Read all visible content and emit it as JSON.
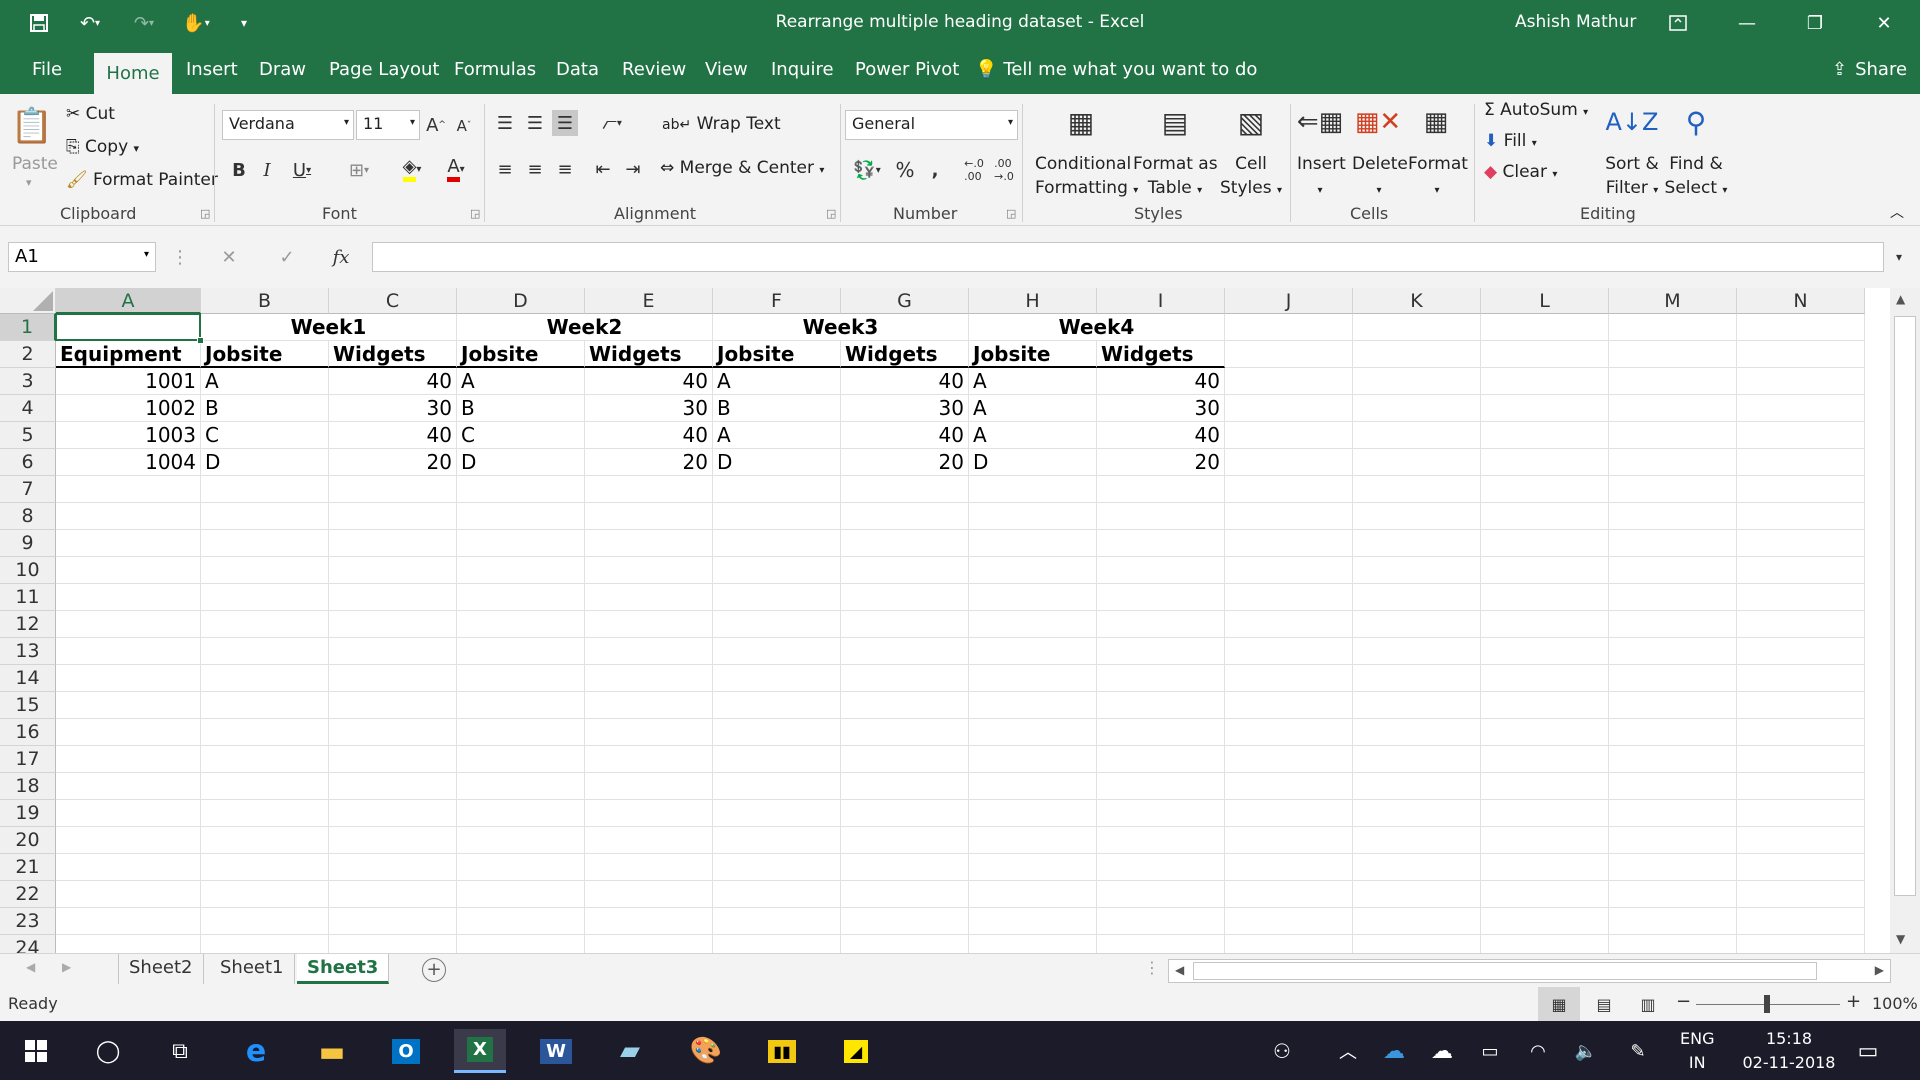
{
  "window": {
    "title": "Rearrange multiple heading dataset  -  Excel",
    "user": "Ashish Mathur"
  },
  "tabs": [
    "File",
    "Home",
    "Insert",
    "Draw",
    "Page Layout",
    "Formulas",
    "Data",
    "Review",
    "View",
    "Inquire",
    "Power Pivot"
  ],
  "tell_me": "Tell me what you want to do",
  "share": "Share",
  "ribbon": {
    "clipboard": {
      "paste": "Paste",
      "cut": "Cut",
      "copy": "Copy",
      "format_painter": "Format Painter",
      "label": "Clipboard"
    },
    "font": {
      "name": "Verdana",
      "size": "11",
      "label": "Font"
    },
    "alignment": {
      "wrap_text": "Wrap Text",
      "merge_center": "Merge & Center",
      "label": "Alignment"
    },
    "number": {
      "format": "General",
      "label": "Number"
    },
    "styles": {
      "conditional_1": "Conditional",
      "conditional_2": "Formatting",
      "format_as_1": "Format as",
      "format_as_2": "Table",
      "cell_1": "Cell",
      "cell_2": "Styles",
      "label": "Styles"
    },
    "cells": {
      "insert": "Insert",
      "delete": "Delete",
      "format": "Format",
      "label": "Cells"
    },
    "editing": {
      "autosum": "AutoSum",
      "fill": "Fill",
      "clear": "Clear",
      "sort_1": "Sort &",
      "sort_2": "Filter",
      "find_1": "Find &",
      "find_2": "Select",
      "label": "Editing"
    }
  },
  "formula_bar": {
    "name_box": "A1",
    "formula": ""
  },
  "columns": [
    "A",
    "B",
    "C",
    "D",
    "E",
    "F",
    "G",
    "H",
    "I",
    "J",
    "K",
    "L",
    "M",
    "N"
  ],
  "rows": [
    "1",
    "2",
    "3",
    "4",
    "5",
    "6",
    "7",
    "8",
    "9",
    "10",
    "11",
    "12",
    "13",
    "14",
    "15",
    "16",
    "17",
    "18",
    "19",
    "20",
    "21",
    "22",
    "23",
    "24"
  ],
  "sheet": {
    "weeks": [
      "Week1",
      "Week2",
      "Week3",
      "Week4"
    ],
    "headers": [
      "Equipment",
      "Jobsite",
      "Widgets",
      "Jobsite",
      "Widgets",
      "Jobsite",
      "Widgets",
      "Jobsite",
      "Widgets"
    ],
    "data": [
      [
        "1001",
        "A",
        "40",
        "A",
        "40",
        "A",
        "40",
        "A",
        "40"
      ],
      [
        "1002",
        "B",
        "30",
        "B",
        "30",
        "B",
        "30",
        "A",
        "30"
      ],
      [
        "1003",
        "C",
        "40",
        "C",
        "40",
        "A",
        "40",
        "A",
        "40"
      ],
      [
        "1004",
        "D",
        "20",
        "D",
        "20",
        "D",
        "20",
        "D",
        "20"
      ]
    ]
  },
  "sheet_tabs": [
    "Sheet2",
    "Sheet1",
    "Sheet3"
  ],
  "active_sheet": "Sheet3",
  "status": {
    "ready": "Ready",
    "zoom": "100%"
  },
  "taskbar": {
    "lang1": "ENG",
    "lang2": "IN",
    "time": "15:18",
    "date": "02-11-2018"
  },
  "colors": {
    "accent": "#217346",
    "taskbar": "#1b1b2a"
  }
}
